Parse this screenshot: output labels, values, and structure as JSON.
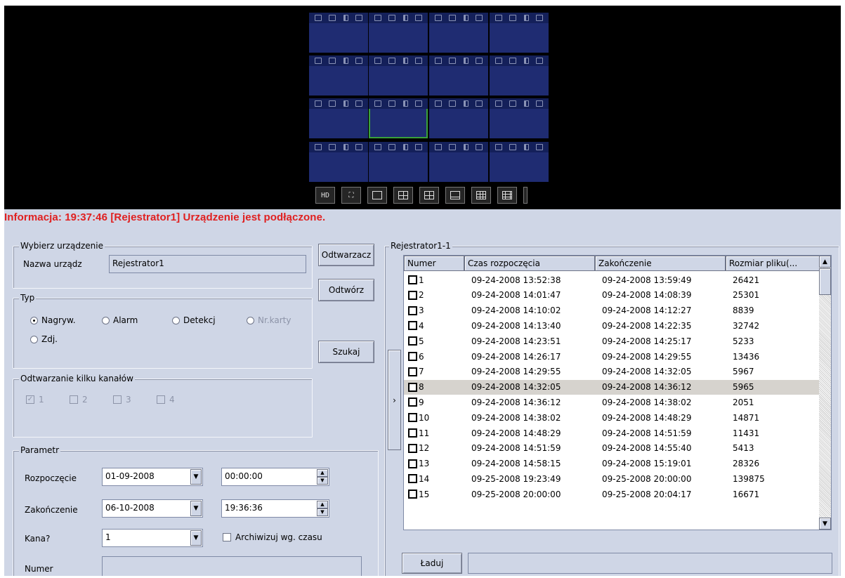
{
  "info": {
    "text": "Informacja:  19:37:46  [Rejestrator1] Urządzenie jest podłączone."
  },
  "toolbar": {
    "hd_label": "HD"
  },
  "device_group": {
    "title": "Wybierz urządzenie",
    "name_label": "Nazwa urządz",
    "name_value": "Rejestrator1"
  },
  "buttons": {
    "player": "Odtwarzacz",
    "play": "Odtwórz",
    "search": "Szukaj",
    "load": "Ładuj"
  },
  "type_group": {
    "title": "Typ",
    "options": [
      {
        "label": "Nagryw.",
        "selected": true,
        "disabled": false
      },
      {
        "label": "Alarm",
        "selected": false,
        "disabled": false
      },
      {
        "label": "Detekcj",
        "selected": false,
        "disabled": false
      },
      {
        "label": "Nr.karty",
        "selected": false,
        "disabled": true
      },
      {
        "label": "Zdj.",
        "selected": false,
        "disabled": false
      }
    ]
  },
  "multi_group": {
    "title": "Odtwarzanie kilku kanałów",
    "channels": [
      {
        "label": "1",
        "checked": true
      },
      {
        "label": "2",
        "checked": false
      },
      {
        "label": "3",
        "checked": false
      },
      {
        "label": "4",
        "checked": false
      }
    ]
  },
  "params": {
    "title": "Parametr",
    "start_label": "Rozpoczęcie",
    "start_date": "01-09-2008",
    "start_time": "00:00:00",
    "end_label": "Zakończenie",
    "end_date": "06-10-2008",
    "end_time": "19:36:36",
    "channel_label": "Kana?",
    "channel_value": "1",
    "archive_label": "Archiwizuj wg. czasu",
    "number_label": "Numer"
  },
  "file_group": {
    "title": "Rejestrator1-1",
    "columns": [
      "Numer",
      "Czas rozpoczęcia",
      "Zakończenie",
      "Rozmiar pliku(..."
    ],
    "rows": [
      [
        "1",
        "09-24-2008 13:52:38",
        "09-24-2008 13:59:49",
        "26421"
      ],
      [
        "2",
        "09-24-2008 14:01:47",
        "09-24-2008 14:08:39",
        "25301"
      ],
      [
        "3",
        "09-24-2008 14:10:02",
        "09-24-2008 14:12:27",
        "8839"
      ],
      [
        "4",
        "09-24-2008 14:13:40",
        "09-24-2008 14:22:35",
        "32742"
      ],
      [
        "5",
        "09-24-2008 14:23:51",
        "09-24-2008 14:25:17",
        "5233"
      ],
      [
        "6",
        "09-24-2008 14:26:17",
        "09-24-2008 14:29:55",
        "13436"
      ],
      [
        "7",
        "09-24-2008 14:29:55",
        "09-24-2008 14:32:05",
        "5967"
      ],
      [
        "8",
        "09-24-2008 14:32:05",
        "09-24-2008 14:36:12",
        "5965"
      ],
      [
        "9",
        "09-24-2008 14:36:12",
        "09-24-2008 14:38:02",
        "2051"
      ],
      [
        "10",
        "09-24-2008 14:38:02",
        "09-24-2008 14:48:29",
        "14871"
      ],
      [
        "11",
        "09-24-2008 14:48:29",
        "09-24-2008 14:51:59",
        "11431"
      ],
      [
        "12",
        "09-24-2008 14:51:59",
        "09-24-2008 14:55:40",
        "5413"
      ],
      [
        "13",
        "09-24-2008 14:58:15",
        "09-24-2008 15:19:01",
        "28326"
      ],
      [
        "14",
        "09-25-2008 19:23:49",
        "09-25-2008 20:00:00",
        "139875"
      ],
      [
        "15",
        "09-25-2008 20:00:00",
        "09-25-2008 20:04:17",
        "16671"
      ]
    ],
    "selected_row": 7
  },
  "colors": {
    "info_text": "#e02020",
    "panel_bg": "#cfd6e6",
    "video_cell": "#1f2c72",
    "selected_cell_border": "#3aa13a"
  }
}
